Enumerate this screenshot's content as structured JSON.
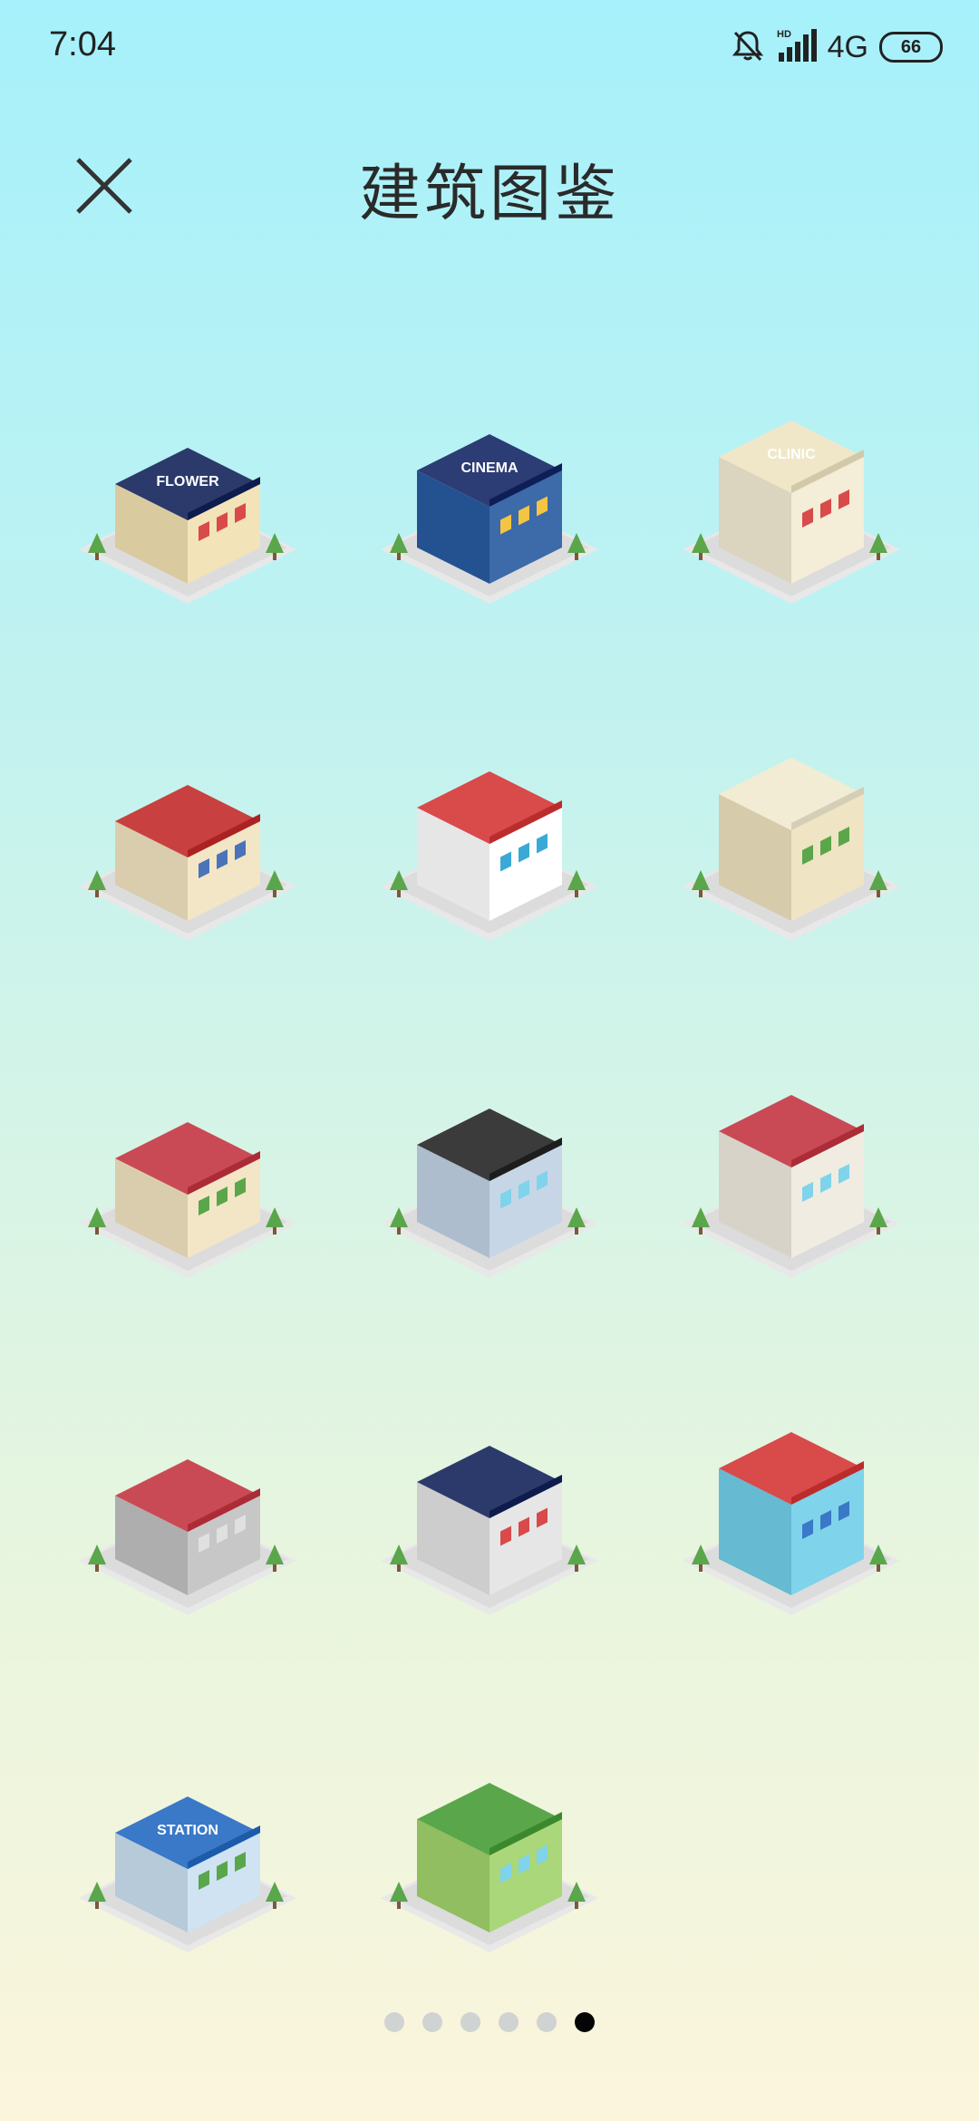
{
  "status_bar": {
    "time": "7:04",
    "network": "4G",
    "battery": "66",
    "icons": [
      "bell-muted-icon",
      "signal-icon"
    ]
  },
  "header": {
    "title": "建筑图鉴",
    "close_icon": "close-icon"
  },
  "buildings": [
    {
      "name": "flower-shop",
      "sign": "FLOWER",
      "roof": "#2b3a6b",
      "wall": "#f3e3b8",
      "accent": "#d94a4a"
    },
    {
      "name": "cinema",
      "sign": "CINEMA",
      "roof": "#2c3c75",
      "wall": "#3d6aa8",
      "accent": "#f4c542"
    },
    {
      "name": "clinic",
      "sign": "CLINIC",
      "roof": "#f0e7c9",
      "wall": "#f4edd7",
      "accent": "#d94a4a"
    },
    {
      "name": "gas-station",
      "sign": "",
      "roof": "#c94040",
      "wall": "#f3e6c6",
      "accent": "#4a73b8"
    },
    {
      "name": "amusement-park",
      "sign": "",
      "roof": "#d94a4a",
      "wall": "#ffffff",
      "accent": "#3aa9d6"
    },
    {
      "name": "museum",
      "sign": "",
      "roof": "#f3ecd4",
      "wall": "#efe4c3",
      "accent": "#5aa64a"
    },
    {
      "name": "school",
      "sign": "",
      "roof": "#c94a55",
      "wall": "#f3e6c6",
      "accent": "#5aa64a"
    },
    {
      "name": "modern-house",
      "sign": "",
      "roof": "#3b3b3b",
      "wall": "#c7d6e6",
      "accent": "#7fd3ea"
    },
    {
      "name": "courtyard-house",
      "sign": "",
      "roof": "#c94a55",
      "wall": "#f0ece2",
      "accent": "#7fd3ea"
    },
    {
      "name": "power-plant",
      "sign": "",
      "roof": "#c94a55",
      "wall": "#c7c7c7",
      "accent": "#e0e0e0"
    },
    {
      "name": "gymnasium",
      "sign": "",
      "roof": "#2b3a6b",
      "wall": "#e6e6e6",
      "accent": "#d94a4a"
    },
    {
      "name": "water-park",
      "sign": "",
      "roof": "#d94a4a",
      "wall": "#7fd3ea",
      "accent": "#3a78c8"
    },
    {
      "name": "station",
      "sign": "STATION",
      "roof": "#3a78c8",
      "wall": "#cfe3f2",
      "accent": "#5aa64a"
    },
    {
      "name": "garden-park",
      "sign": "",
      "roof": "#5aa64a",
      "wall": "#a9d77a",
      "accent": "#7fd3ea"
    }
  ],
  "pagination": {
    "total": 6,
    "current": 6
  }
}
